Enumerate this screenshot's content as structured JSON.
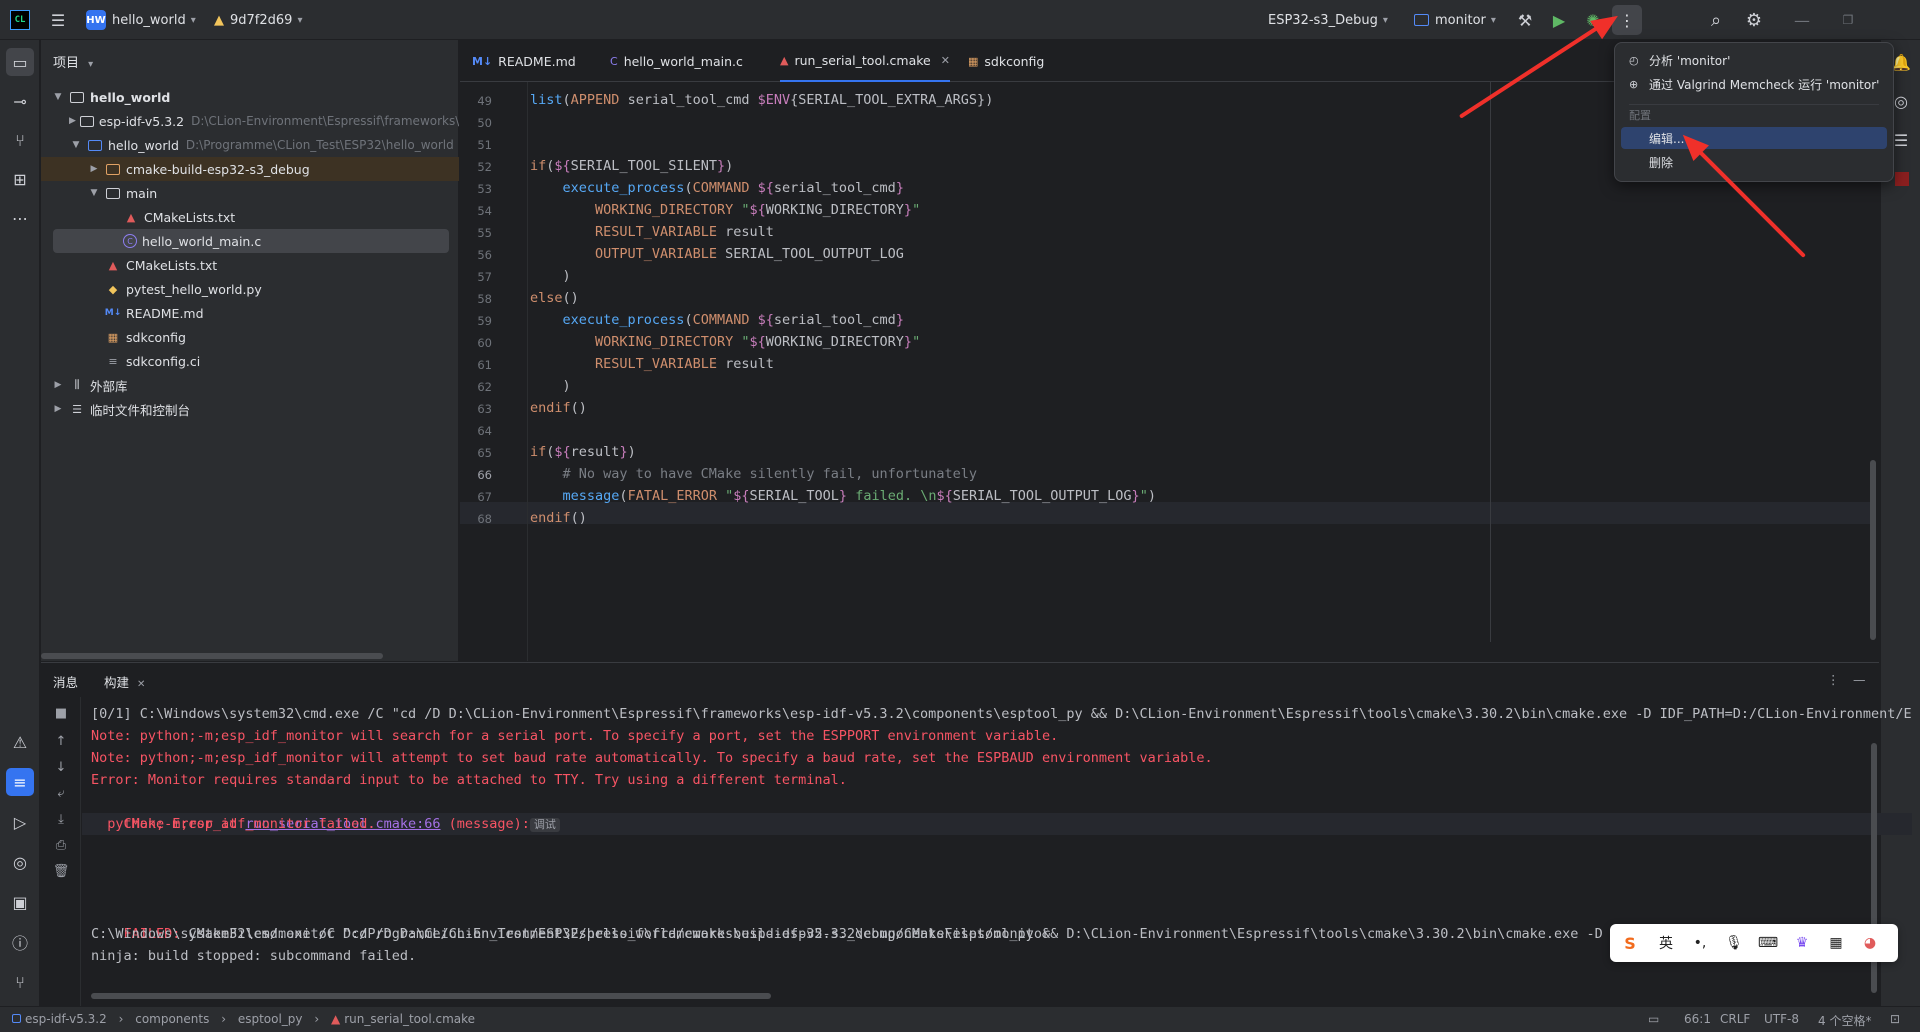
{
  "titlebar": {
    "app_icon": "clion-logo",
    "project_badge": "HW",
    "project_name": "hello_world",
    "vcs_warning_icon": "warning-icon",
    "commit": "9d7f2d69",
    "run_config_target": "ESP32-s3_Debug",
    "run_config": "monitor"
  },
  "left_strip": {
    "icons": [
      "folder-icon",
      "commit-icon",
      "pull-request-icon",
      "structure-icon",
      "more-icon",
      "warning-icon",
      "build-icon",
      "run-icon",
      "services-icon",
      "terminal-icon",
      "problems-icon",
      "git-icon"
    ]
  },
  "project": {
    "header": "项目",
    "tree": [
      {
        "label": "hello_world",
        "path": ""
      },
      {
        "label": "esp-idf-v5.3.2",
        "path": "D:\\CLion-Environment\\Espressif\\frameworks\\"
      },
      {
        "label": "hello_world",
        "path": "D:\\Programme\\CLion_Test\\ESP32\\hello_world"
      },
      {
        "label": "cmake-build-esp32-s3_debug",
        "path": ""
      },
      {
        "label": "main",
        "path": ""
      },
      {
        "label": "CMakeLists.txt",
        "path": ""
      },
      {
        "label": "hello_world_main.c",
        "path": ""
      },
      {
        "label": "CMakeLists.txt",
        "path": ""
      },
      {
        "label": "pytest_hello_world.py",
        "path": ""
      },
      {
        "label": "README.md",
        "path": ""
      },
      {
        "label": "sdkconfig",
        "path": ""
      },
      {
        "label": "sdkconfig.ci",
        "path": ""
      },
      {
        "label": "外部库",
        "path": ""
      },
      {
        "label": "临时文件和控制台",
        "path": ""
      }
    ]
  },
  "editor": {
    "tabs": [
      {
        "label": "README.md",
        "icon_text": "M↓"
      },
      {
        "label": "hello_world_main.c",
        "icon_text": "C"
      },
      {
        "label": "run_serial_tool.cmake",
        "icon_text": "▲"
      },
      {
        "label": "sdkconfig",
        "icon_text": "▦"
      }
    ],
    "line_numbers": [
      "49",
      "50",
      "51",
      "52",
      "53",
      "54",
      "55",
      "56",
      "57",
      "58",
      "59",
      "60",
      "61",
      "62",
      "63",
      "64",
      "65",
      "66",
      "67",
      "68"
    ]
  },
  "build": {
    "tabs": [
      "消息",
      "构建"
    ],
    "lines": [
      "[0/1] C:\\Windows\\system32\\cmd.exe /C \"cd /D D:\\CLion-Environment\\Espressif\\frameworks\\esp-idf-v5.3.2\\components\\esptool_py && D:\\CLion-Environment\\Espressif\\tools\\cmake\\3.30.2\\bin\\cmake.exe -D IDF_PATH=D:/CLion-Environment/E",
      "Note: python;-m;esp_idf_monitor will search for a serial port. To specify a port, set the ESPPORT environment variable.",
      "Note: python;-m;esp_idf_monitor will attempt to set baud rate automatically. To specify a baud rate, set the ESPBAUD environment variable.",
      "Error: Monitor requires standard input to be attached to TTY. Try using a different terminal.",
      "CMake Error at ",
      "run_serial_tool.cmake:66",
      " (message):",
      "调试",
      "  python;-m;esp_idf_monitor failed.",
      "FAILED: ",
      "CMakeFiles/monitor D:/Programme/CLion_Test/ESP32/hello_world/cmake-build-esp32-s3_debug/CMakeFiles/monitor",
      "C:\\Windows\\system32\\cmd.exe /C \"cd /D D:\\CLion-Environment\\Espressif\\frameworks\\esp-idf-v5.3.2\\components\\esptool_py && D:\\CLion-Environment\\Espressif\\tools\\cmake\\3.30.2\\bin\\cmake.exe -D IDF",
      "ninja: build stopped: subcommand failed."
    ]
  },
  "popup": {
    "items": [
      "分析 'monitor'",
      "通过 Valgrind Memcheck 运行 'monitor'"
    ],
    "group_label": "配置",
    "config_items": [
      "编辑...",
      "删除"
    ]
  },
  "statusbar": {
    "breadcrumb": [
      "esp-idf-v5.3.2",
      "components",
      "esptool_py",
      "run_serial_tool.cmake"
    ],
    "position": "66:1",
    "line_ending": "CRLF",
    "encoding": "UTF-8",
    "indent": "4 个空格*"
  },
  "ime": {
    "lang": "英"
  },
  "colors": {
    "accent": "#3574f0",
    "error": "#f75464",
    "annotation": "#f0302a"
  }
}
